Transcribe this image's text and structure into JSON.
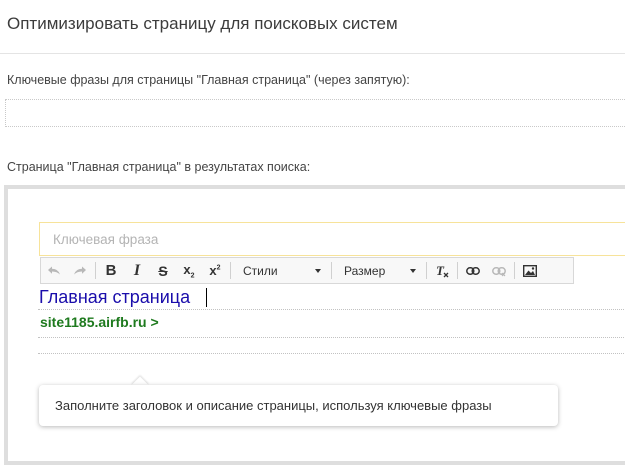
{
  "header": {
    "title": "Оптимизировать страницу для поисковых систем"
  },
  "keywords": {
    "label": "Ключевые фразы для страницы \"Главная страница\" (через запятую):",
    "value": ""
  },
  "preview": {
    "label": "Страница \"Главная страница\" в результатах поиска:",
    "keyphrase_placeholder": "Ключевая фраза",
    "title": "Главная страница",
    "url": "site1185.airfb.ru >",
    "description": ""
  },
  "toolbar": {
    "undo_icon": "undo-icon",
    "redo_icon": "redo-icon",
    "bold_glyph": "B",
    "italic_glyph": "I",
    "strike_glyph": "S",
    "subscript_glyph": "x",
    "superscript_glyph": "x",
    "styles_label": "Стили",
    "size_label": "Размер",
    "clear_format_icon": "remove-format-icon",
    "link_icon": "link-icon",
    "unlink_icon": "unlink-icon",
    "image_icon": "image-icon"
  },
  "tooltip": {
    "text": "Заполните заголовок и описание страницы, используя ключевые фразы"
  },
  "colors": {
    "title_link": "#1a0dab",
    "url_green": "#1e7a1e",
    "keyphrase_border": "#f7e39a",
    "frame_border": "#dedede"
  }
}
